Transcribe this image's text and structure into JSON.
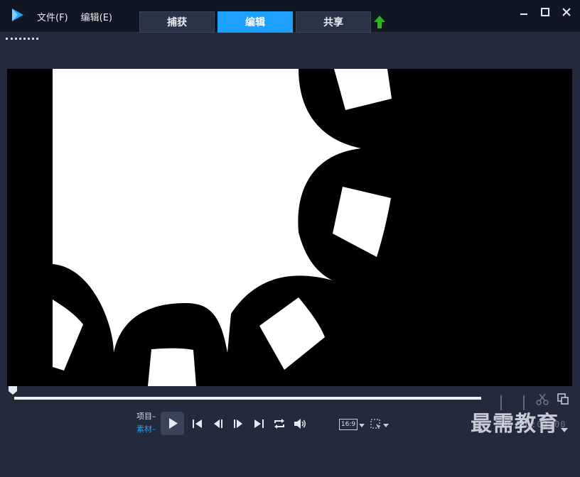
{
  "menu": {
    "file": "文件(F)",
    "edit": "编辑(E)"
  },
  "tabs": [
    {
      "label": "捕获",
      "active": false
    },
    {
      "label": "编辑",
      "active": true
    },
    {
      "label": "共享",
      "active": false
    }
  ],
  "colors": {
    "accent": "#1ea0ff",
    "upload": "#2fb21a",
    "clip_mode": "#22a4ff"
  },
  "icons": {
    "app": "app-logo-icon",
    "upload": "upload-arrow-icon",
    "minimize": "minimize-icon",
    "maximize": "maximize-icon",
    "close": "close-icon"
  },
  "player": {
    "mode_project": "项目",
    "mode_clip": "素材",
    "aspect_ratio": "16:9",
    "timecode": "00:00:02:00",
    "scrub_position": 0
  },
  "watermark": "最需教育"
}
